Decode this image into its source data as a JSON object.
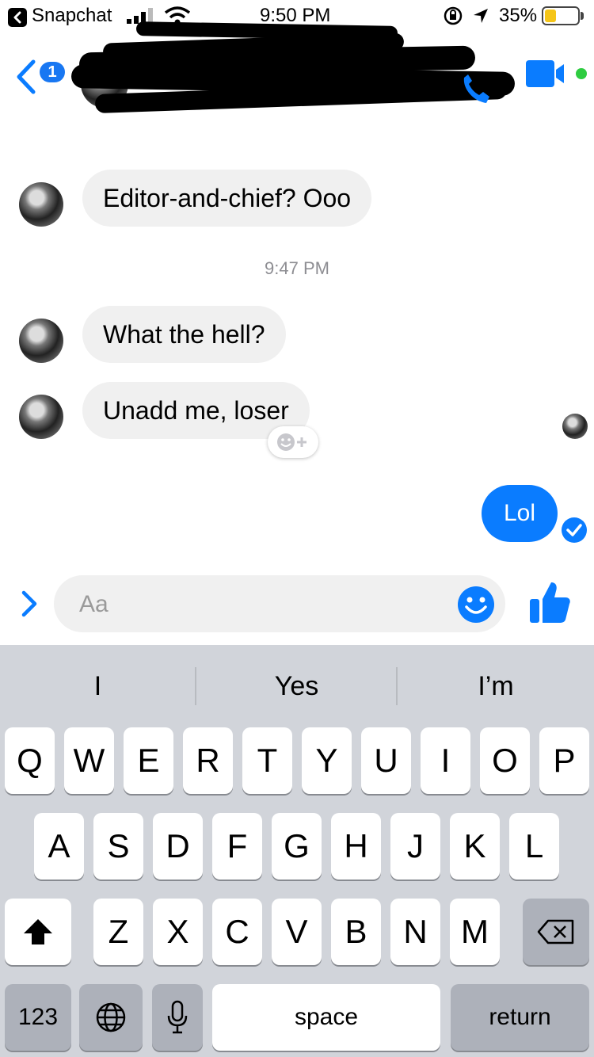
{
  "status_bar": {
    "back_app": "Snapchat",
    "time": "9:50 PM",
    "battery": "35%",
    "battery_level": 0.35
  },
  "header": {
    "unread_count": "1"
  },
  "messages": [
    {
      "text": "Editor-and-chief? Ooo"
    },
    {
      "text": "What the hell?"
    },
    {
      "text": "Unadd me, loser"
    }
  ],
  "timestamp": "9:47 PM",
  "outgoing": {
    "text": "Lol"
  },
  "composer": {
    "placeholder": "Aa"
  },
  "keyboard": {
    "suggestions": [
      "I",
      "Yes",
      "I’m"
    ],
    "row1": [
      "Q",
      "W",
      "E",
      "R",
      "T",
      "Y",
      "U",
      "I",
      "O",
      "P"
    ],
    "row2": [
      "A",
      "S",
      "D",
      "F",
      "G",
      "H",
      "J",
      "K",
      "L"
    ],
    "row3": [
      "Z",
      "X",
      "C",
      "V",
      "B",
      "N",
      "M"
    ],
    "numbers": "123",
    "space": "space",
    "return": "return"
  },
  "colors": {
    "accent": "#0a7cff",
    "presence": "#2ecc40",
    "battery": "#f5c518"
  },
  "icons": [
    "chevron-left-icon",
    "signal-icon",
    "wifi-icon",
    "orientation-lock-icon",
    "location-icon",
    "battery-icon",
    "phone-icon",
    "video-icon",
    "emoji-add-icon",
    "read-check-icon",
    "chevron-right-icon",
    "emoji-icon",
    "thumbs-up-icon",
    "shift-icon",
    "delete-icon",
    "globe-icon",
    "microphone-icon"
  ]
}
